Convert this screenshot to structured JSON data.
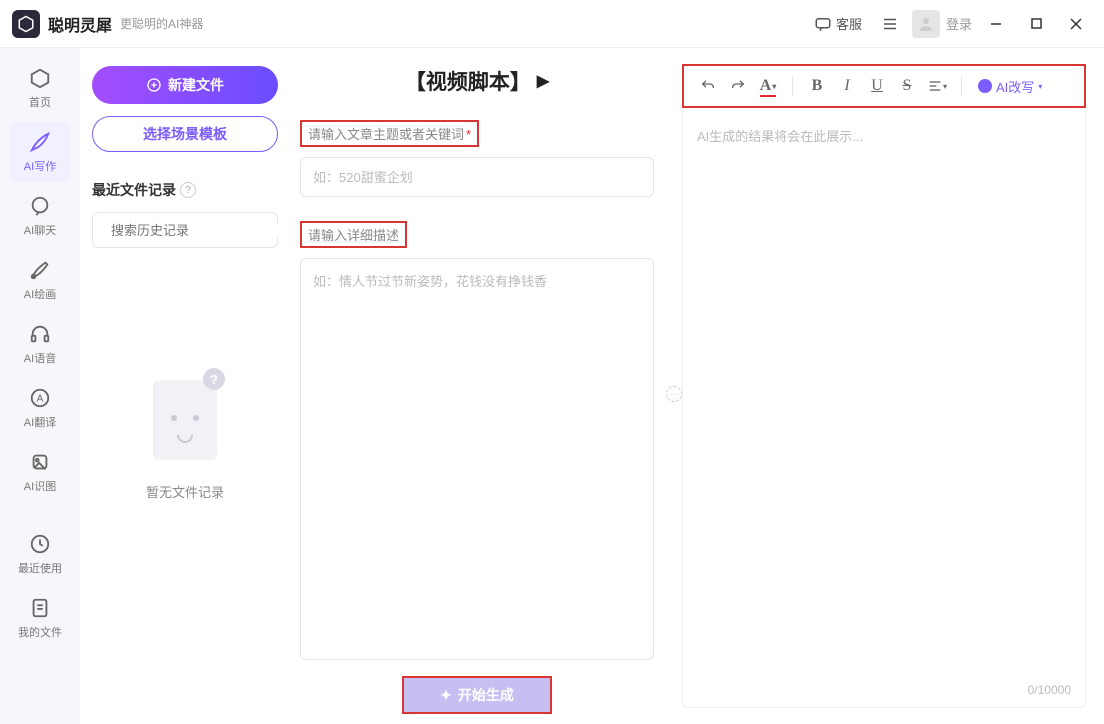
{
  "app": {
    "brand": "聪明灵犀",
    "tagline": "更聪明的AI神器"
  },
  "header": {
    "service": "客服",
    "login": "登录"
  },
  "sidebar": {
    "items": [
      {
        "label": "首页"
      },
      {
        "label": "AI写作"
      },
      {
        "label": "AI聊天"
      },
      {
        "label": "AI绘画"
      },
      {
        "label": "AI语音"
      },
      {
        "label": "AI翻译"
      },
      {
        "label": "AI识图"
      },
      {
        "label": "最近使用"
      },
      {
        "label": "我的文件"
      }
    ]
  },
  "files": {
    "new_button": "新建文件",
    "template_button": "选择场景模板",
    "history_title": "最近文件记录",
    "search_placeholder": "搜索历史记录",
    "empty_text": "暂无文件记录"
  },
  "input": {
    "page_title": "【视频脚本】",
    "topic_label": "请输入文章主题或者关键词",
    "topic_placeholder": "如：520甜蜜企划",
    "detail_label": "请输入详细描述",
    "detail_placeholder": "如：情人节过节新姿势，花钱没有挣钱香",
    "generate_button": "开始生成"
  },
  "output": {
    "ai_rewrite": "AI改写",
    "placeholder": "AI生成的结果将会在此展示...",
    "counter": "0/10000"
  }
}
